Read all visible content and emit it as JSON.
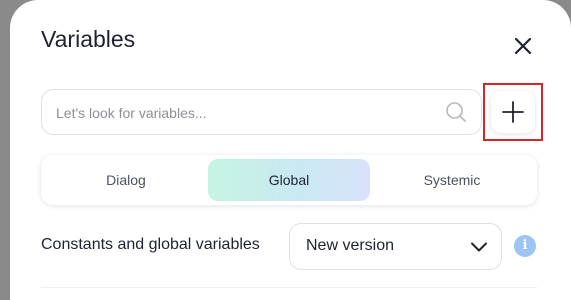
{
  "dialog": {
    "title": "Variables"
  },
  "search": {
    "placeholder": "Let's look for variables...",
    "value": ""
  },
  "tabs": [
    {
      "label": "Dialog",
      "active": false
    },
    {
      "label": "Global",
      "active": true
    },
    {
      "label": "Systemic",
      "active": false
    }
  ],
  "constants": {
    "label": "Constants and global variables",
    "selected_version": "New version"
  },
  "icons": {
    "close": "close-icon",
    "search": "search-icon",
    "add": "plus-icon",
    "chevron": "chevron-down-icon",
    "info": "info-icon",
    "info_glyph": "i"
  },
  "colors": {
    "highlight_border": "#d8252b",
    "active_tab_gradient": [
      "#c6f4e1",
      "#d7e2fb"
    ],
    "info_icon": "#9ec4f3"
  }
}
